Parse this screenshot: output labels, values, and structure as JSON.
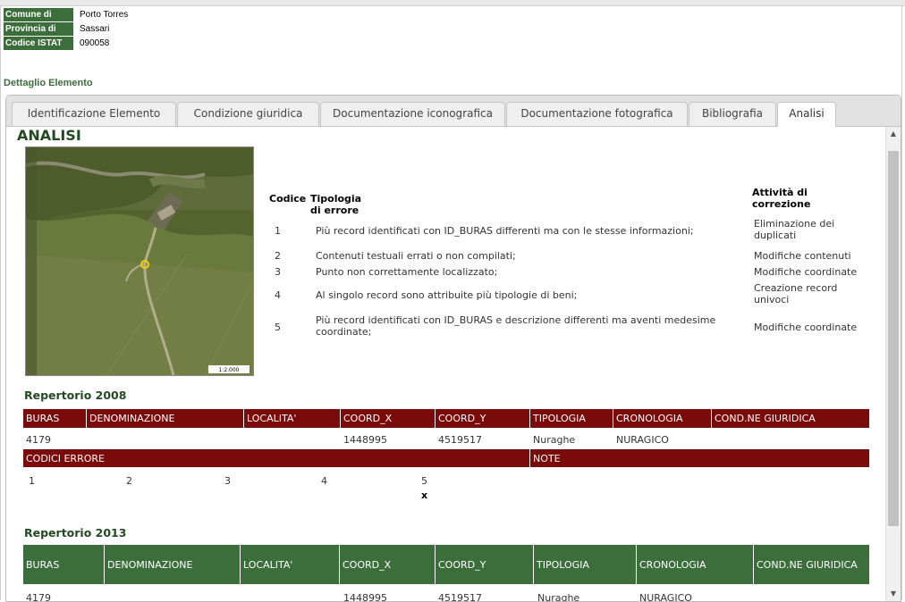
{
  "info": {
    "rows": [
      {
        "label": "Comune di",
        "value": "Porto Torres"
      },
      {
        "label": "Provincia di",
        "value": "Sassari"
      },
      {
        "label": "Codice ISTAT",
        "value": "090058"
      }
    ]
  },
  "section_title": "Dettaglio Elemento",
  "tabs": [
    {
      "label": "Identificazione Elemento"
    },
    {
      "label": "Condizione giuridica"
    },
    {
      "label": "Documentazione iconografica"
    },
    {
      "label": "Documentazione fotografica"
    },
    {
      "label": "Bibliografia"
    },
    {
      "label": "Analisi"
    }
  ],
  "analisi": {
    "title": "ANALISI",
    "map_scale": "1:2.000",
    "colors": {
      "dark_green": "#3c6e3c",
      "dark_red": "#7b0a0a"
    },
    "error_table": {
      "headers": {
        "code": "Codice",
        "type": "Tipologia di errore",
        "action": "Attività di correzione"
      },
      "rows": [
        {
          "code": "1",
          "desc": "Più record identificati con ID_BURAS differenti ma con le stesse informazioni;",
          "action": "Eliminazione dei duplicati"
        },
        {
          "code": "2",
          "desc": "Contenuti testuali errati o non compilati;",
          "action": "Modifiche contenuti"
        },
        {
          "code": "3",
          "desc": "Punto non correttamente localizzato;",
          "action": "Modifiche coordinate"
        },
        {
          "code": "4",
          "desc": "Al singolo record sono attribuite più tipologie di beni;",
          "action": "Creazione record univoci"
        },
        {
          "code": "5",
          "desc": "Più record identificati con ID_BURAS e descrizione differenti ma aventi medesime coordinate;",
          "action": "Modifiche coordinate"
        }
      ]
    }
  },
  "rep2008": {
    "title": "Repertorio 2008",
    "headers": [
      "BURAS",
      "DENOMINAZIONE",
      "LOCALITA'",
      "COORD_X",
      "COORD_Y",
      "TIPOLOGIA",
      "CRONOLOGIA",
      "COND.NE GIURIDICA"
    ],
    "row": [
      "4179",
      "",
      "",
      "1448995",
      "4519517",
      "Nuraghe",
      "NURAGICO",
      ""
    ],
    "err_headers": [
      "CODICI ERRORE",
      "NOTE"
    ],
    "err_codes": [
      "1",
      "2",
      "3",
      "4",
      "5"
    ],
    "err_mark": "x"
  },
  "rep2013": {
    "title": "Repertorio 2013",
    "headers": [
      "BURAS",
      "DENOMINAZIONE",
      "LOCALITA'",
      "COORD_X",
      "COORD_Y",
      "TIPOLOGIA",
      "CRONOLOGIA",
      "COND.NE GIURIDICA"
    ],
    "row": [
      "4179",
      "",
      "",
      "1448995",
      "4519517",
      "Nuraghe",
      "NURAGICO",
      ""
    ]
  }
}
